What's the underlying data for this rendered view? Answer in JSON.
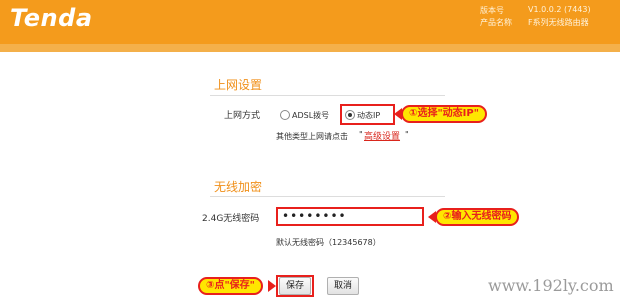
{
  "header": {
    "logo": "Tenda",
    "version_label": "版本号",
    "version_value": "V1.0.0.2 (7443)",
    "product_label": "产品名称",
    "product_value": "F系列无线路由器"
  },
  "internet": {
    "title": "上网设置",
    "mode_label": "上网方式",
    "options": [
      "ADSL拨号",
      "动态IP"
    ],
    "selected": "动态IP",
    "other_text": "其他类型上网请点击",
    "advanced_link": "高级设置",
    "quote_open": "\"",
    "quote_close": "\""
  },
  "wireless": {
    "title": "无线加密",
    "password_label": "2.4G无线密码",
    "password_value": "••••••••",
    "default_hint": "默认无线密码（12345678）"
  },
  "buttons": {
    "save": "保存",
    "cancel": "取消"
  },
  "annotations": {
    "step1": "①选择\"动态IP\"",
    "step2": "②输入无线密码",
    "step3": "③点\"保存\""
  },
  "watermark": "www.192ly.com",
  "colors": {
    "header_orange": "#f49b1c",
    "section_title": "#f0901a",
    "annotation_red": "#e8201c",
    "annotation_fill": "#ffe600"
  }
}
